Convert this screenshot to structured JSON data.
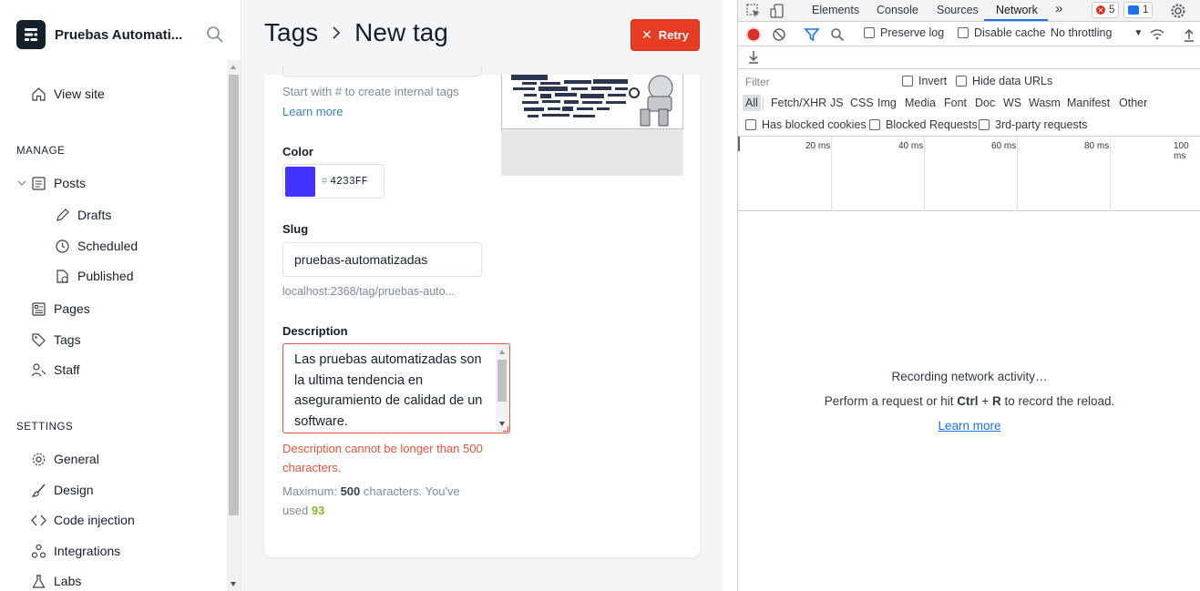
{
  "sidebar": {
    "site_title": "Pruebas Automati...",
    "view_site": "View site",
    "manage_title": "MANAGE",
    "posts": "Posts",
    "drafts": "Drafts",
    "scheduled": "Scheduled",
    "published": "Published",
    "pages": "Pages",
    "tags": "Tags",
    "staff": "Staff",
    "settings_title": "SETTINGS",
    "general": "General",
    "design": "Design",
    "code_injection": "Code injection",
    "integrations": "Integrations",
    "labs": "Labs"
  },
  "header": {
    "crumb_parent": "Tags",
    "crumb_current": "New tag",
    "retry_label": "Retry"
  },
  "form": {
    "name_help": "Start with # to create internal tags",
    "learn_more": "Learn more",
    "color_label": "Color",
    "color_hash": "#",
    "color_value": "4233FF",
    "slug_label": "Slug",
    "slug_value": "pruebas-automatizadas",
    "slug_url": "localhost:2368/tag/pruebas-auto...",
    "description_label": "Description",
    "description_value": "Las pruebas automatizadas son la ultima tendencia en aseguramiento de calidad de un software.",
    "error_text": "Description cannot be longer than 500 characters.",
    "max_prefix": "Maximum:",
    "max_value": "500",
    "max_mid": "characters. You've used",
    "used_value": "93"
  },
  "devtools": {
    "tabs": [
      "Elements",
      "Console",
      "Sources",
      "Network"
    ],
    "more_tabs": "»",
    "errors_count": "5",
    "messages_count": "1",
    "preserve_log": "Preserve log",
    "disable_cache": "Disable cache",
    "throttling": "No throttling",
    "filter_placeholder": "Filter",
    "invert": "Invert",
    "hide_data_urls": "Hide data URLs",
    "types": [
      "All",
      "Fetch/XHR",
      "JS",
      "CSS",
      "Img",
      "Media",
      "Font",
      "Doc",
      "WS",
      "Wasm",
      "Manifest",
      "Other"
    ],
    "has_blocked_cookies": "Has blocked cookies",
    "blocked_requests": "Blocked Requests",
    "third_party": "3rd-party requests",
    "timeline_labels": [
      "20 ms",
      "40 ms",
      "60 ms",
      "80 ms",
      "100 ms"
    ],
    "recording": "Recording network activity…",
    "perform_prefix": "Perform a request or hit",
    "ctrl": "Ctrl",
    "plus": "+",
    "r_key": "R",
    "perform_suffix": "to record the reload.",
    "learn_more": "Learn more"
  },
  "colors": {
    "accent_red": "#e63c24",
    "tag_color": "#4233ff",
    "link_blue": "#1a73e8",
    "used_green": "#8bb526"
  }
}
